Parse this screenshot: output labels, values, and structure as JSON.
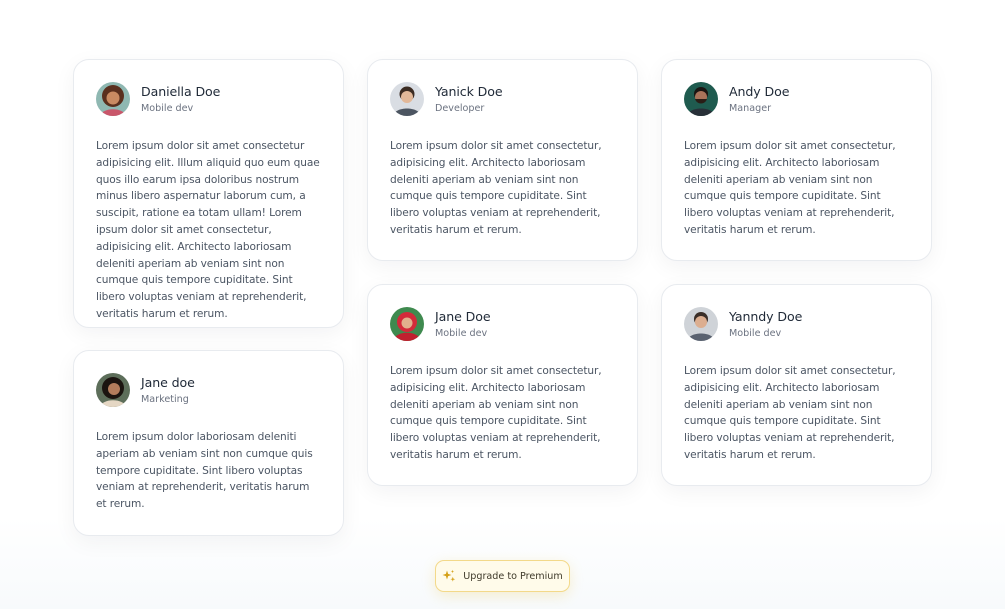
{
  "testimonials": [
    {
      "name": "Daniella Doe",
      "role": "Mobile dev",
      "avatar_icon": "avatar-photo-woman-curly-hair",
      "text": "Lorem ipsum dolor sit amet consectetur adipisicing elit. Illum aliquid quo eum quae quos illo earum ipsa doloribus nostrum minus libero aspernatur laborum cum, a suscipit, ratione ea totam ullam! Lorem ipsum dolor sit amet consectetur, adipisicing elit. Architecto laboriosam deleniti aperiam ab veniam sint non cumque quis tempore cupiditate. Sint libero voluptas veniam at reprehenderit, veritatis harum et rerum."
    },
    {
      "name": "Yanick Doe",
      "role": "Developer",
      "avatar_icon": "avatar-photo-man",
      "text": "Lorem ipsum dolor sit amet consectetur, adipisicing elit. Architecto laboriosam deleniti aperiam ab veniam sint non cumque quis tempore cupiditate. Sint libero voluptas veniam at reprehenderit, veritatis harum et rerum."
    },
    {
      "name": "Andy Doe",
      "role": "Manager",
      "avatar_icon": "avatar-photo-man-beard",
      "text": "Lorem ipsum dolor sit amet consectetur, adipisicing elit. Architecto laboriosam deleniti aperiam ab veniam sint non cumque quis tempore cupiditate. Sint libero voluptas veniam at reprehenderit, veritatis harum et rerum."
    },
    {
      "name": "Jane doe",
      "role": "Marketing",
      "avatar_icon": "avatar-photo-woman-dark-hair",
      "text": "Lorem ipsum dolor laboriosam deleniti aperiam ab veniam sint non cumque quis tempore cupiditate. Sint libero voluptas veniam at reprehenderit, veritatis harum et rerum."
    },
    {
      "name": "Jane Doe",
      "role": "Mobile dev",
      "avatar_icon": "avatar-photo-woman-red-hijab",
      "text": "Lorem ipsum dolor sit amet consectetur, adipisicing elit. Architecto laboriosam deleniti aperiam ab veniam sint non cumque quis tempore cupiditate. Sint libero voluptas veniam at reprehenderit, veritatis harum et rerum."
    },
    {
      "name": "Yanndy Doe",
      "role": "Mobile dev",
      "avatar_icon": "avatar-photo-man-short-hair",
      "text": "Lorem ipsum dolor sit amet consectetur, adipisicing elit. Architecto laboriosam deleniti aperiam ab veniam sint non cumque quis tempore cupiditate. Sint libero voluptas veniam at reprehenderit, veritatis harum et rerum."
    }
  ],
  "upgrade": {
    "label": "Upgrade to Premium",
    "icon": "sparkles-icon",
    "accent": "#d4a017"
  }
}
